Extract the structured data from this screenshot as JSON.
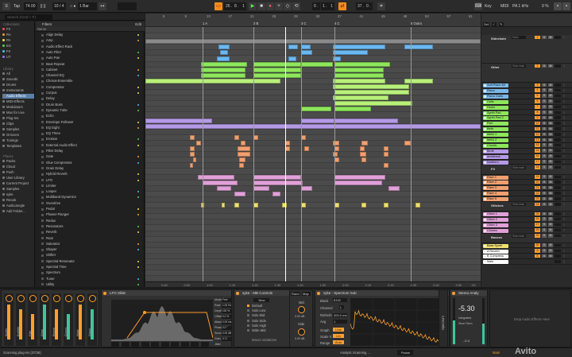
{
  "transport": {
    "tap": "Tap",
    "tempo": "74.00",
    "metro_a": "|| ||",
    "signature": "10 / 4",
    "metro_b": "○ ●",
    "quantize": "1 Bar",
    "pos_a": "26 .",
    "pos_b": "8 .",
    "pos_c": "1",
    "pos_d": "0 .",
    "pos_e": "1 .",
    "pos_f": "1",
    "loop_len": "37 .",
    "loop_b": "0 .",
    "key_label": "Key",
    "midi_label": "MIDI",
    "cpu": "PA 1 kHz",
    "pct": "9 %"
  },
  "search": {
    "placeholder": "Search (Cmd + F)"
  },
  "sidebar": {
    "collections_label": "Collections",
    "collections": [
      {
        "label": "FX",
        "color": "#ff4b4b"
      },
      {
        "label": "RA",
        "color": "#ff9e2c"
      },
      {
        "label": "PA",
        "color": "#f6e14b"
      },
      {
        "label": "EG",
        "color": "#4fd64f"
      },
      {
        "label": "FX",
        "color": "#3ec6f0"
      },
      {
        "label": "UT",
        "color": "#a070e8"
      }
    ],
    "library_label": "Library",
    "library": [
      "All",
      "Sounds",
      "Drums",
      "Instruments",
      "Audio Effects",
      "MIDI Effects",
      "Modulators",
      "Max for Live",
      "Plug-Ins",
      "Clips",
      "Samples",
      "Grooves",
      "Tunings",
      "Templates"
    ],
    "places_label": "Places",
    "places": [
      "Packs",
      "Cloud",
      "Push",
      "User Library",
      "Current Project",
      "Samples",
      "syke",
      "Rnook",
      "AudioJungle",
      "Add Folder..."
    ]
  },
  "browser": {
    "filters_label": "Filters",
    "edit_label": "Edit",
    "name_col": "Name",
    "items": [
      "Align Delay",
      "Amp",
      "Audio Effect Rack",
      "Auto Filter",
      "Auto Pan",
      "Beat Repeat",
      "Cabinet",
      "Channel EQ",
      "Chorus-Ensemble",
      "Compressor",
      "Corpus",
      "Delay",
      "Drum Buss",
      "Dynamic Tube",
      "Echo",
      "Envelope Follower",
      "EQ Eight",
      "EQ Three",
      "Erosion",
      "External Audio Effect",
      "Filter Delay",
      "Gate",
      "Glue Compressor",
      "Grain Delay",
      "Hybrid Reverb",
      "LFO",
      "Limiter",
      "Looper",
      "Multiband Dynamics",
      "Overdrive",
      "Pedal",
      "Phaser-Flanger",
      "Redux",
      "Resonators",
      "Reverb",
      "Roar",
      "Saturator",
      "Shaper",
      "Shifter",
      "Spectral Resonator",
      "Spectral Time",
      "Spectrum",
      "Tuner",
      "Utility"
    ]
  },
  "arrangement": {
    "bars": [
      "5",
      "9",
      "13",
      "17",
      "21",
      "25",
      "29",
      "33",
      "37",
      "41",
      "45",
      "49",
      "53",
      "57",
      "61"
    ],
    "locators": [
      "1 A",
      "2 B",
      "3 C",
      "4 C",
      "5 Outro"
    ],
    "times": [
      "0:40",
      "0:50",
      "1:00",
      "1:10",
      "1:20",
      "1:30",
      "1:40",
      "1:50",
      "2:00",
      "2:10",
      "2:20",
      "2:30",
      "2:40",
      "2:50"
    ],
    "zoom": "2/1",
    "colors": {
      "blue": "#6ab8f0",
      "green": "#8ee65c",
      "lime": "#b8f07a",
      "purple": "#b49ae6",
      "orange": "#f0a070",
      "pink": "#e0a0d8",
      "yellow": "#f0e070"
    }
  },
  "mixer": {
    "set_label": "Set",
    "rows": [
      {
        "name": "Sidechain",
        "group": true,
        "route": "Main",
        "num": "1",
        "color": "#ffffff"
      },
      {
        "name": "Other",
        "group": true,
        "route": "Sidechain",
        "num": "2",
        "color": "#ffffff"
      },
      {
        "name": "Soft Piano MI",
        "route": "",
        "num": "3",
        "color": "#7ab8e8"
      },
      {
        "name": "Piano",
        "route": "",
        "num": "4",
        "color": "#7ab8e8"
      },
      {
        "name": "Piano Outro",
        "route": "",
        "num": "5",
        "color": "#7ab8e8"
      },
      {
        "name": "Cello",
        "route": "",
        "num": "6",
        "color": "#8ee65c"
      },
      {
        "name": "Horns",
        "route": "",
        "num": "7",
        "color": "#8ee65c"
      },
      {
        "name": "Synth Pad",
        "route": "",
        "num": "8",
        "color": "#8ee65c"
      },
      {
        "name": "Synth Pad 2",
        "route": "",
        "num": "9",
        "color": "#8ee65c"
      },
      {
        "name": "Pad",
        "route": "",
        "num": "10",
        "color": "#8ee65c"
      },
      {
        "name": "Bells",
        "route": "",
        "num": "11",
        "color": "#8ee65c"
      },
      {
        "name": "Mello 1",
        "route": "",
        "num": "12",
        "color": "#8ee65c"
      },
      {
        "name": "Mello 2",
        "route": "",
        "num": "13",
        "color": "#8ee65c"
      },
      {
        "name": "Chords",
        "route": "",
        "num": "14",
        "color": "#8ee65c"
      },
      {
        "name": "Birds",
        "route": "",
        "num": "15",
        "color": "#b49ae6"
      },
      {
        "name": "Ambience",
        "route": "",
        "num": "16",
        "color": "#b49ae6"
      },
      {
        "name": "Northern",
        "route": "",
        "num": "17",
        "color": "#b49ae6"
      },
      {
        "name": "FX",
        "group": true,
        "route": "Sidechain",
        "num": "18",
        "color": "#ffffff"
      },
      {
        "name": "Riser 1",
        "route": "",
        "num": "19",
        "color": "#f0a070"
      },
      {
        "name": "Riser 2",
        "route": "",
        "num": "20",
        "color": "#f0a070"
      },
      {
        "name": "Riser 3",
        "route": "",
        "num": "21",
        "color": "#f0a070"
      },
      {
        "name": "Riser 4",
        "route": "",
        "num": "22",
        "color": "#f0a070"
      },
      {
        "name": "Riser 5",
        "route": "",
        "num": "23",
        "color": "#f0a070"
      },
      {
        "name": "Glitches",
        "group": true,
        "route": "Sidechain",
        "num": "24",
        "color": "#ffffff"
      },
      {
        "name": "Glitch 1",
        "route": "",
        "num": "25",
        "color": "#e0a0d8"
      },
      {
        "name": "Glitch 2",
        "route": "",
        "num": "26",
        "color": "#e0a0d8"
      },
      {
        "name": "Glitch 3",
        "route": "",
        "num": "27",
        "color": "#e0a0d8"
      },
      {
        "name": "Chimes",
        "route": "",
        "num": "28",
        "color": "#e0a0d8"
      },
      {
        "name": "Basses",
        "group": true,
        "route": "Sidechain",
        "num": "29",
        "color": "#ffffff"
      },
      {
        "name": "Bass Synth",
        "route": "",
        "num": "30",
        "color": "#f0e070"
      },
      {
        "name": "A Reverb",
        "route": "",
        "num": "A",
        "color": "#ffffff"
      },
      {
        "name": "B Compress",
        "route": "",
        "num": "B",
        "color": "#ffffff"
      },
      {
        "name": "Main",
        "route": "",
        "num": "",
        "color": "#ffffff"
      }
    ],
    "solo": "S",
    "mute": "M"
  },
  "devices": {
    "lfo_title": "LFO Slide",
    "comp_title": "syke - MB Controls",
    "comp_params": [
      "Default",
      "Solo Low",
      "Solo Mid",
      "Solo Side",
      "Solo High",
      "Wide Mid"
    ],
    "comp_buttons": [
      "New",
      "Rand",
      "Map"
    ],
    "macro_variations": "Macro Variations",
    "mid_label": "Mid",
    "side_label": "Side",
    "mid_val": "0.00 dB",
    "side_val": "0.00 dB",
    "spectrum_title": "syke - Spectrum Sub",
    "block_label": "Block",
    "block_val": "8192",
    "channel_label": "Channel",
    "channel_val": "L",
    "refresh_label": "Refresh",
    "refresh_val": "300.0 ms",
    "avg_label": "Avg",
    "avg_val": "1",
    "graph_label": "Graph",
    "graph_val": "Line",
    "scale_label": "Scale X",
    "scale_val": "Lin",
    "range_label": "Range",
    "range_val": "Auto",
    "spectrum_side": "Spectrum",
    "stereo_title": "Stereo Analy",
    "lufs": "-5.30",
    "integrated_label": "Integrated",
    "short_term": "Short Term",
    "meter_val": "-12.8",
    "drop_hint": "Drop Audio Effects Here",
    "lfo_labels": [
      "Mode",
      "Rate",
      "Depth",
      "Offset",
      "Attack",
      "Phase",
      "Smooth",
      "Gain",
      "Jitter"
    ],
    "lfo_vals": [
      "Free",
      "1.00 Hz",
      "100 %",
      "0.0 %",
      "0.00 ms",
      "0.0 °",
      "0.00 dB",
      "0.71"
    ],
    "track_strip_labels": [
      "Stutter",
      "Dry/Wet",
      "Filter",
      "Delay",
      "Reverb",
      "Chorus",
      "Width",
      "Output"
    ]
  },
  "status": {
    "message": "Scanning plug-ins (37/38)",
    "analytic": "Analytic Scanning ...",
    "pause": "Pause",
    "main": "Main",
    "watermark": "Avito"
  }
}
